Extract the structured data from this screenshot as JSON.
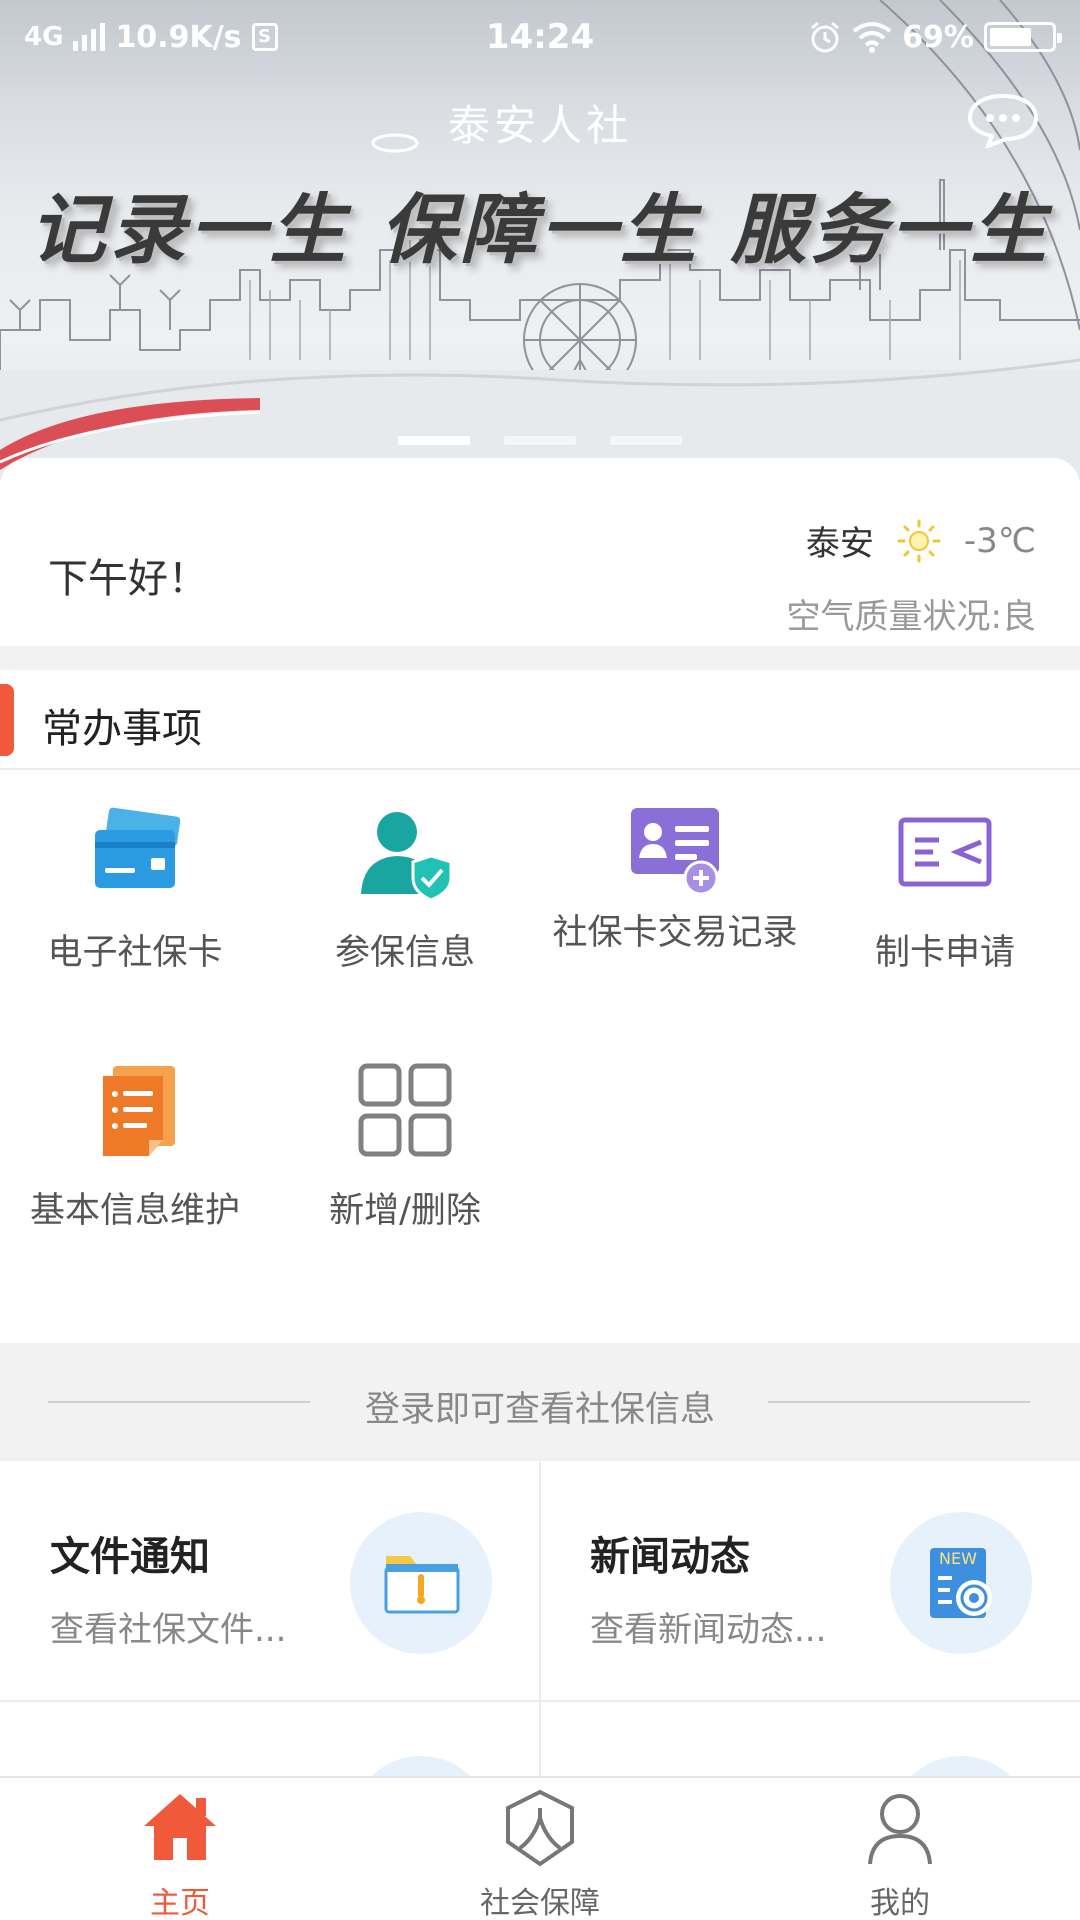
{
  "status_bar": {
    "network": "4G",
    "speed": "10.9K/s",
    "s_icon": "S",
    "time": "14:24",
    "battery": "69%",
    "battery_level": 0.69
  },
  "header": {
    "title": "泰安人社",
    "slogan": "记录一生 保障一生 服务一生",
    "chat_icon": "chat-bubble-icon",
    "carousel_pages": 3,
    "carousel_active": 0
  },
  "greeting": {
    "text": "下午好！",
    "city": "泰安",
    "weather_icon": "sun-icon",
    "temperature": "-3℃",
    "air_quality": "空气质量状况:良"
  },
  "common": {
    "title": "常办事项",
    "accent": "#f05a3a",
    "items": [
      {
        "label": "电子社保卡",
        "icon": "card-icon"
      },
      {
        "label": "参保信息",
        "icon": "person-shield-icon"
      },
      {
        "label": "社保卡交易记录",
        "icon": "id-card-plus-icon"
      },
      {
        "label": "制卡申请",
        "icon": "card-apply-icon"
      },
      {
        "label": "基本信息维护",
        "icon": "document-list-icon"
      },
      {
        "label": "新增/删除",
        "icon": "grid-icon"
      }
    ]
  },
  "login_prompt": "登录即可查看社保信息",
  "cards": [
    {
      "title": "文件通知",
      "subtitle": "查看社保文件...",
      "icon": "folder-icon"
    },
    {
      "title": "新闻动态",
      "subtitle": "查看新闻动态...",
      "icon": "news-icon",
      "badge": "NEW"
    }
  ],
  "tabbar": {
    "active_color": "#f05a3a",
    "items": [
      {
        "label": "主页",
        "icon": "home-icon"
      },
      {
        "label": "社会保障",
        "icon": "social-security-icon"
      },
      {
        "label": "我的",
        "icon": "user-icon"
      }
    ]
  }
}
